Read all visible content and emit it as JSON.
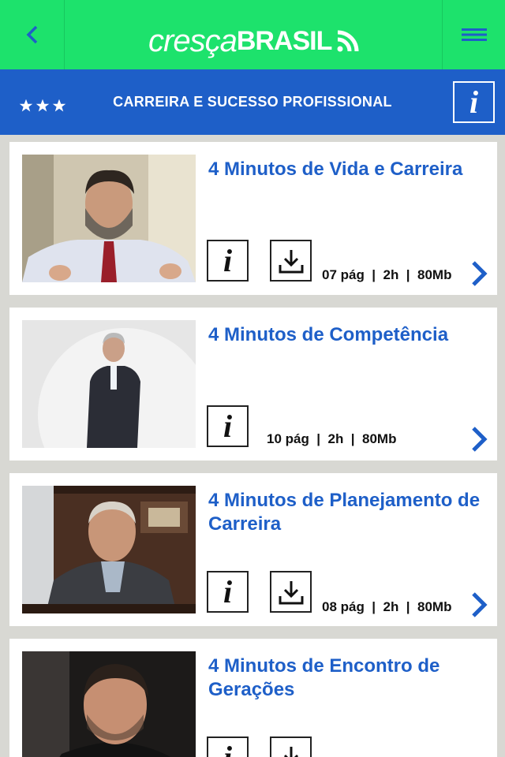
{
  "header": {
    "logo_part1": "cresça",
    "logo_part2": "BRASIL",
    "accent_color": "#1de26c"
  },
  "category": {
    "title": "CARREIRA E SUCESSO PROFISSIONAL",
    "stars": 3,
    "color": "#1e5fc8"
  },
  "courses": [
    {
      "title": "4 Minutos de Vida e Carreira",
      "pages": "07 pág",
      "duration": "2h",
      "size": "80Mb",
      "meta": "07 pág  |  2h  |  80Mb",
      "has_download": true
    },
    {
      "title": "4 Minutos de Competência",
      "pages": "10 pág",
      "duration": "2h",
      "size": "80Mb",
      "meta": "10 pág  |  2h  |  80Mb",
      "has_download": false
    },
    {
      "title": "4 Minutos de Planejamento de Carreira",
      "pages": "08 pág",
      "duration": "2h",
      "size": "80Mb",
      "meta": "08 pág  |  2h  |  80Mb",
      "has_download": true
    },
    {
      "title": "4 Minutos de Encontro de Gerações",
      "has_download": true
    }
  ],
  "icons": {
    "back": "chevron-left-icon",
    "menu": "hamburger-icon",
    "info": "info-icon",
    "download": "download-icon",
    "next": "chevron-right-icon"
  }
}
